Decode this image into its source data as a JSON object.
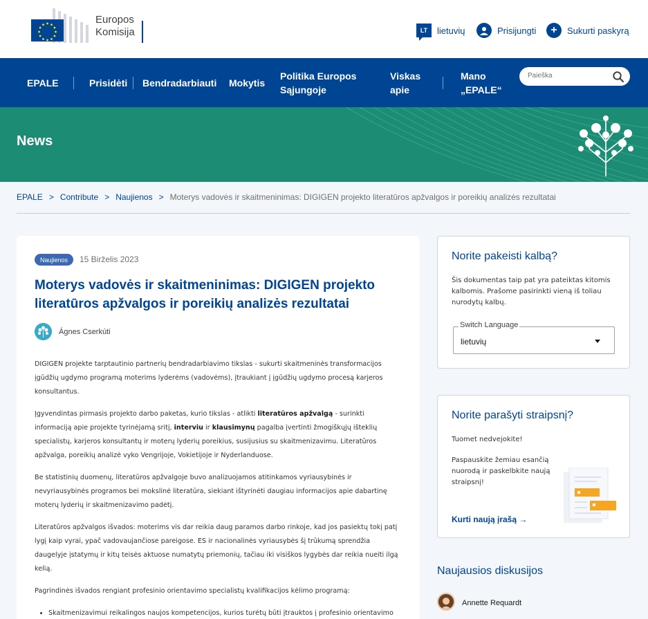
{
  "header": {
    "logo_line1": "Europos",
    "logo_line2": "Komisija",
    "lang_code": "LT",
    "lang_label": "lietuvių",
    "login_label": "Prisijungti",
    "register_label": "Sukurti paskyrą"
  },
  "nav": {
    "items": [
      "EPALE",
      "Prisidėti",
      "Bendradarbiauti",
      "Mokytis",
      "Politika Europos Sąjungoje",
      "Viskas apie",
      "Mano „EPALE“"
    ],
    "search_placeholder": "Paieška"
  },
  "banner": {
    "title": "News"
  },
  "breadcrumb": {
    "items": [
      "EPALE",
      "Contribute",
      "Naujienos"
    ],
    "current": "Moterys vadovės ir skaitmeninimas: DIGIGEN projekto literatūros apžvalgos ir poreikių analizės rezultatai"
  },
  "article": {
    "tag": "Naujienos",
    "date": "15 Birželis 2023",
    "title": "Moterys vadovės ir skaitmeninimas: DIGIGEN projekto literatūros apžvalgos ir poreikių analizės rezultatai",
    "author": "Ágnes Cserkúti",
    "p1": "DIGIGEN projekte tarptautinio partnerių bendradarbiavimo tikslas - sukurti skaitmeninės transformacijos įgūdžių ugdymo programą moterims lyderėms (vadovėms), įtraukiant į įgūdžių ugdymo procesą karjeros konsultantus.",
    "p2_a": "Įgyvendintas pirmasis projekto darbo paketas, kurio tikslas -  atlikti ",
    "p2_b1": "literatūros apžvalgą",
    "p2_c": " - surinkti informaciją apie projekte tyrinėjamą sritį, ",
    "p2_b2": "interviu",
    "p2_d": " ir ",
    "p2_b3": "klausimynų",
    "p2_e": " pagalba įvertinti žmogiškųjų išteklių specialistų, karjeros konsultantų ir moterų lyderių poreikius, susijusius su skaitmenizavimu. Literatūros apžvalga,  poreikių analizė vyko Vengrijoje, Vokietijoje ir Nyderlanduose.",
    "p3": "Be statistinių duomenų, literatūros apžvalgoje buvo analizuojamos atitinkamos vyriausybinės ir nevyriausybinės programos bei mokslinė literatūra, siekiant ištyrinėti daugiau informacijos apie dabartinę moterų lyderių ir skaitmenizavimo padėtį.",
    "p4": " Literatūros apžvalgos išvados: moterims vis dar reikia daug paramos darbo rinkoje, kad jos pasiektų tokį patį lygį kaip vyrai, ypač vadovaujančiose pareigose. ES ir nacionalinės vyriausybės šį trūkumą sprendžia daugelyje įstatymų ir kitų teisės aktuose numatytų priemonių, tačiau iki visiškos lygybės dar reikia nueiti ilgą kelią.",
    "p5": "Pagrindinės išvados rengiant profesinio orientavimo specialistų kvalifikacijos kėlimo programą:",
    "bullet1": "Skaitmenizavimui reikalingos naujos kompetencijos, kurios turėtų būti įtrauktos į profesinio orientavimo specialistų kvalifikacijos kėlimo programą, kad šias kompetencijas būtų galima"
  },
  "sidebar": {
    "lang_card": {
      "title": "Norite pakeisti kalbą?",
      "text": "Šis dokumentas taip pat yra pateiktas kitomis kalbomis. Prašome pasirinkti vieną iš toliau nurodytų kalbų.",
      "select_label": "Switch Language",
      "select_value": "lietuvių"
    },
    "write_card": {
      "title": "Norite parašyti straipsnį?",
      "text1": "Tuomet nedvejokite!",
      "text2": "Paspauskite žemiau esančią nuorodą ir paskelbkite naują straipsnį!",
      "link": "Kurti naują įrašą →"
    },
    "discussions": {
      "title": "Naujausios diskusijos",
      "first_author": "Annette Requardt"
    }
  },
  "colors": {
    "brand_blue": "#004494",
    "banner_green": "#1c8c74",
    "tag_blue": "#3c69b4"
  }
}
